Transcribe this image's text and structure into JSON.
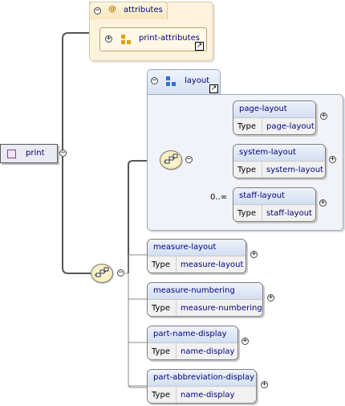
{
  "root": {
    "name": "print"
  },
  "attributes": {
    "label": "attributes",
    "at_symbol": "@",
    "group": {
      "name": "print-attributes"
    }
  },
  "layout": {
    "name": "layout",
    "children": [
      {
        "name": "page-layout",
        "type_label": "Type",
        "type": "page-layout"
      },
      {
        "name": "system-layout",
        "type_label": "Type",
        "type": "system-layout"
      },
      {
        "name": "staff-layout",
        "type_label": "Type",
        "type": "staff-layout",
        "cardinality": "0..∞"
      }
    ]
  },
  "elements": [
    {
      "name": "measure-layout",
      "type_label": "Type",
      "type": "measure-layout"
    },
    {
      "name": "measure-numbering",
      "type_label": "Type",
      "type": "measure-numbering"
    },
    {
      "name": "part-name-display",
      "type_label": "Type",
      "type": "name-display"
    },
    {
      "name": "part-abbreviation-display",
      "type_label": "Type",
      "type": "name-display"
    }
  ],
  "icons": {
    "collapse": "minus-circle-icon",
    "expand": "plus-circle-icon",
    "sequence": "sequence-icon",
    "link": "link-arrow-icon"
  },
  "colors": {
    "header_gradient_top": "#eef3fb",
    "header_gradient_bottom": "#d2def1",
    "attr_bg": "#fdf3dc",
    "group_bg": "#f1f3f8",
    "text": "#000080"
  }
}
